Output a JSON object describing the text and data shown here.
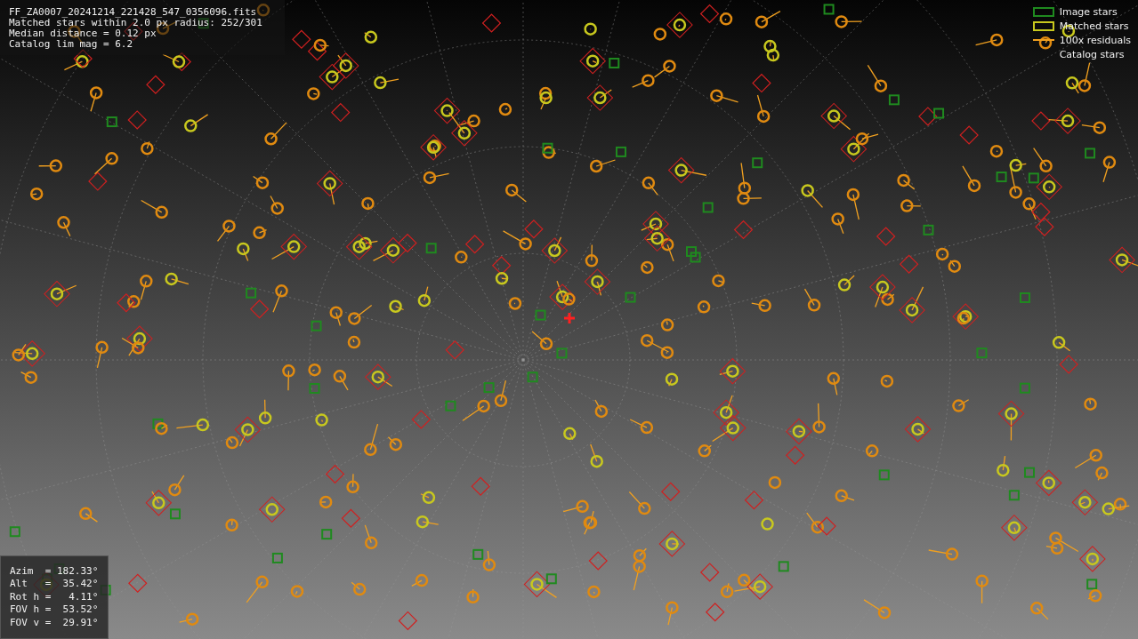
{
  "info": {
    "lines": [
      "FF_ZA0007_20241214_221428_547_0356096.fits",
      "Matched stars within 2.0 px radius: 252/301",
      "Median distance = 0.12 px",
      "Catalog lim mag = 6.2"
    ]
  },
  "legend": [
    {
      "kind": "image",
      "label": "Image stars",
      "color": "#1f8a1f"
    },
    {
      "kind": "matched",
      "label": "Matched stars",
      "color": "#c8c81e"
    },
    {
      "kind": "residual",
      "label": "100x residuals",
      "color": "#f0a020"
    },
    {
      "kind": "catalog",
      "label": "Catalog stars"
    }
  ],
  "pointing": {
    "lines": [
      "Azim  = 182.33°",
      "Alt   =  35.42°",
      "Rot h =   4.11°",
      "FOV h =  53.52°",
      "FOV v =  29.91°"
    ]
  }
}
